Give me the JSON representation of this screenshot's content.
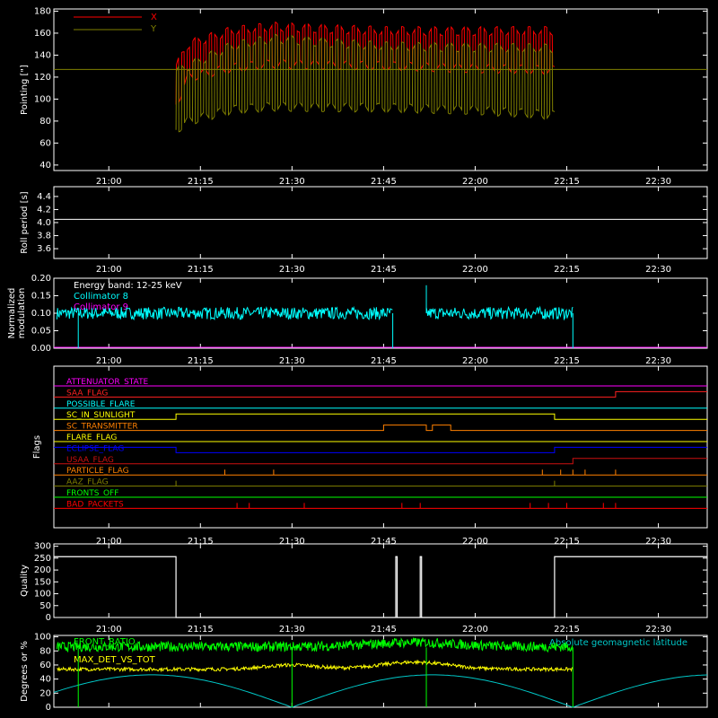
{
  "time_ticks": [
    "21:00",
    "21:15",
    "21:30",
    "21:45",
    "22:00",
    "22:15",
    "22:30"
  ],
  "time_tick_minutes": [
    1260,
    1275,
    1290,
    1305,
    1320,
    1335,
    1350
  ],
  "x_range_minutes": [
    1251,
    1358
  ],
  "colors": {
    "bg": "#000000",
    "axis": "#ffffff",
    "red": "#ff0000",
    "olive": "#808000",
    "cyan": "#00ffff",
    "magenta": "#ff00ff",
    "yellow": "#ffff00",
    "orange": "#ff8000",
    "blue": "#0000ff",
    "green": "#00ff00",
    "dkred": "#cc1010",
    "teal": "#00c8c8"
  },
  "chart_data": [
    {
      "type": "line",
      "ylabel": "Pointing [\"]",
      "ylim": [
        35,
        182
      ],
      "yticks": [
        40,
        60,
        80,
        100,
        120,
        140,
        160,
        180
      ],
      "data_start": "21:11",
      "data_end": "22:13",
      "series": [
        {
          "name": "X",
          "color": "#ff0000",
          "envelope_x": [
            "21:11",
            "21:13",
            "21:20",
            "21:27",
            "21:45",
            "22:00",
            "22:13"
          ],
          "upper": [
            130,
            150,
            162,
            166,
            162,
            162,
            162
          ],
          "lower": [
            95,
            120,
            128,
            132,
            130,
            128,
            126
          ]
        },
        {
          "name": "Y",
          "color": "#808000",
          "envelope_x": [
            "21:11",
            "21:13",
            "21:20",
            "21:27",
            "21:45",
            "22:00",
            "22:13"
          ],
          "upper": [
            125,
            130,
            148,
            155,
            148,
            147,
            146
          ],
          "lower": [
            72,
            80,
            90,
            93,
            92,
            90,
            85
          ]
        }
      ],
      "reference_level": 127
    },
    {
      "type": "line",
      "ylabel": "Roll period [s]",
      "ylim": [
        3.45,
        4.55
      ],
      "yticks": [
        3.6,
        3.8,
        4.0,
        4.2,
        4.4
      ],
      "series": [
        {
          "color": "#ffffff",
          "level": 4.05
        }
      ]
    },
    {
      "type": "line",
      "ylabel": "Normalized modulation",
      "ylim": [
        0,
        0.2
      ],
      "yticks": [
        0.0,
        0.05,
        0.1,
        0.15,
        0.2
      ],
      "annotation": "Energy band: 12-25 keV",
      "series": [
        {
          "name": "Collimator 8",
          "color": "#00ffff",
          "mean": 0.1,
          "gaps": [
            [
              "21:46",
              "21:48"
            ],
            [
              "21:48",
              "21:49"
            ]
          ],
          "start": "21:00",
          "end": "22:25"
        },
        {
          "name": "Collimator 9",
          "color": "#ff00ff",
          "level": 0.0
        }
      ]
    },
    {
      "type": "line",
      "ylabel": "Flags",
      "flags": [
        {
          "name": "ATTENUATOR_STATE",
          "color": "#ff00ff",
          "steps": []
        },
        {
          "name": "SAA_FLAG",
          "color": "#ff2020",
          "steps": [
            [
              "22:23",
              1
            ]
          ]
        },
        {
          "name": "POSSIBLE_FLARE",
          "color": "#00ffff",
          "steps": []
        },
        {
          "name": "SC_IN_SUNLIGHT",
          "color": "#ffff00",
          "steps": [
            [
              "21:11",
              1
            ],
            [
              "22:13",
              0
            ]
          ]
        },
        {
          "name": "SC_TRANSMITTER",
          "color": "#ff8000",
          "steps": [
            [
              "21:45",
              1
            ],
            [
              "21:52",
              0
            ],
            [
              "21:53",
              1
            ],
            [
              "21:56",
              0
            ]
          ]
        },
        {
          "name": "FLARE_FLAG",
          "color": "#ffff00",
          "steps": []
        },
        {
          "name": "ECLIPSE_FLAG",
          "color": "#0000ff",
          "steps": [
            [
              "21:11",
              0
            ],
            [
              "22:13",
              1
            ]
          ]
        },
        {
          "name": "USAA_FLAG",
          "color": "#cc1010",
          "steps": [
            [
              "22:16",
              1
            ]
          ]
        },
        {
          "name": "PARTICLE_FLAG",
          "color": "#ff8000",
          "spikes": [
            "21:19",
            "21:27",
            "22:11",
            "22:14",
            "22:16",
            "22:18",
            "22:23"
          ]
        },
        {
          "name": "AAZ_FLAG",
          "color": "#808000",
          "spikes": [
            "21:11",
            "22:13"
          ]
        },
        {
          "name": "FRONTS_OFF",
          "color": "#00ff00",
          "steps": []
        },
        {
          "name": "BAD_PACKETS",
          "color": "#ff0000",
          "spikes": [
            "21:21",
            "21:23",
            "21:32",
            "21:48",
            "21:51",
            "22:09",
            "22:12",
            "22:15",
            "22:21",
            "22:23"
          ]
        }
      ]
    },
    {
      "type": "line",
      "ylabel": "Quality",
      "ylim": [
        0,
        310
      ],
      "yticks": [
        0,
        50,
        100,
        150,
        200,
        250,
        300
      ],
      "series": [
        {
          "color": "#ffffff",
          "high_intervals": [
            [
              "20:51",
              "21:11"
            ],
            [
              "21:47",
              "21:47"
            ],
            [
              "21:51",
              "21:51"
            ],
            [
              "22:13",
              "22:38"
            ]
          ],
          "level": 256
        }
      ]
    },
    {
      "type": "line",
      "ylabel": "Degrees or %",
      "ylim": [
        0,
        102
      ],
      "yticks": [
        0,
        20,
        40,
        60,
        80,
        100
      ],
      "annotation": "Absolute geomagnetic latitude",
      "series": [
        {
          "name": "FRONT_RATIO",
          "color": "#00ff00",
          "mean": 88
        },
        {
          "name": "MAX_DET_VS_TOT",
          "color": "#ffff00",
          "mean": 55
        },
        {
          "name": "Absolute geomagnetic latitude",
          "color": "#00c8c8"
        }
      ]
    }
  ]
}
